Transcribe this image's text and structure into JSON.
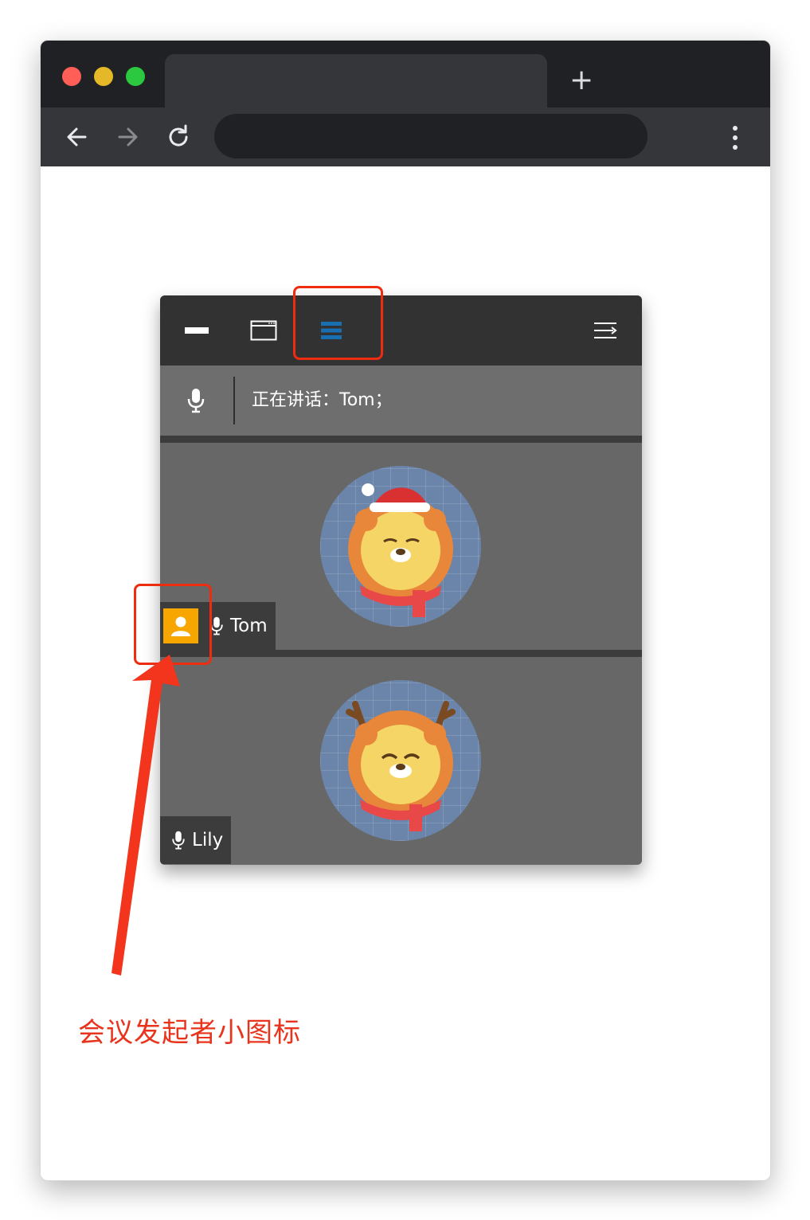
{
  "browser": {
    "new_tab_label": "+",
    "icons": {
      "back": "arrow-left-icon",
      "forward": "arrow-right-icon",
      "reload": "reload-icon",
      "menu": "kebab-menu-icon"
    }
  },
  "meeting_widget": {
    "toolbar": {
      "icons": [
        "minimize-icon",
        "window-icon",
        "list-layout-icon",
        "collapse-panel-icon"
      ],
      "active_color": "#1a6fb0"
    },
    "speaking_bar": {
      "icon": "microphone-icon",
      "text": "正在讲话：Tom；"
    },
    "participants": [
      {
        "name": "Tom",
        "is_host": true,
        "host_icon": "host-user-icon",
        "mic_icon": "microphone-icon",
        "avatar": "lion-santa-hat-avatar"
      },
      {
        "name": "Lily",
        "is_host": false,
        "mic_icon": "microphone-icon",
        "avatar": "lion-reindeer-antlers-avatar"
      }
    ]
  },
  "annotation": {
    "text": "会议发起者小图标",
    "color": "#e8341c"
  }
}
